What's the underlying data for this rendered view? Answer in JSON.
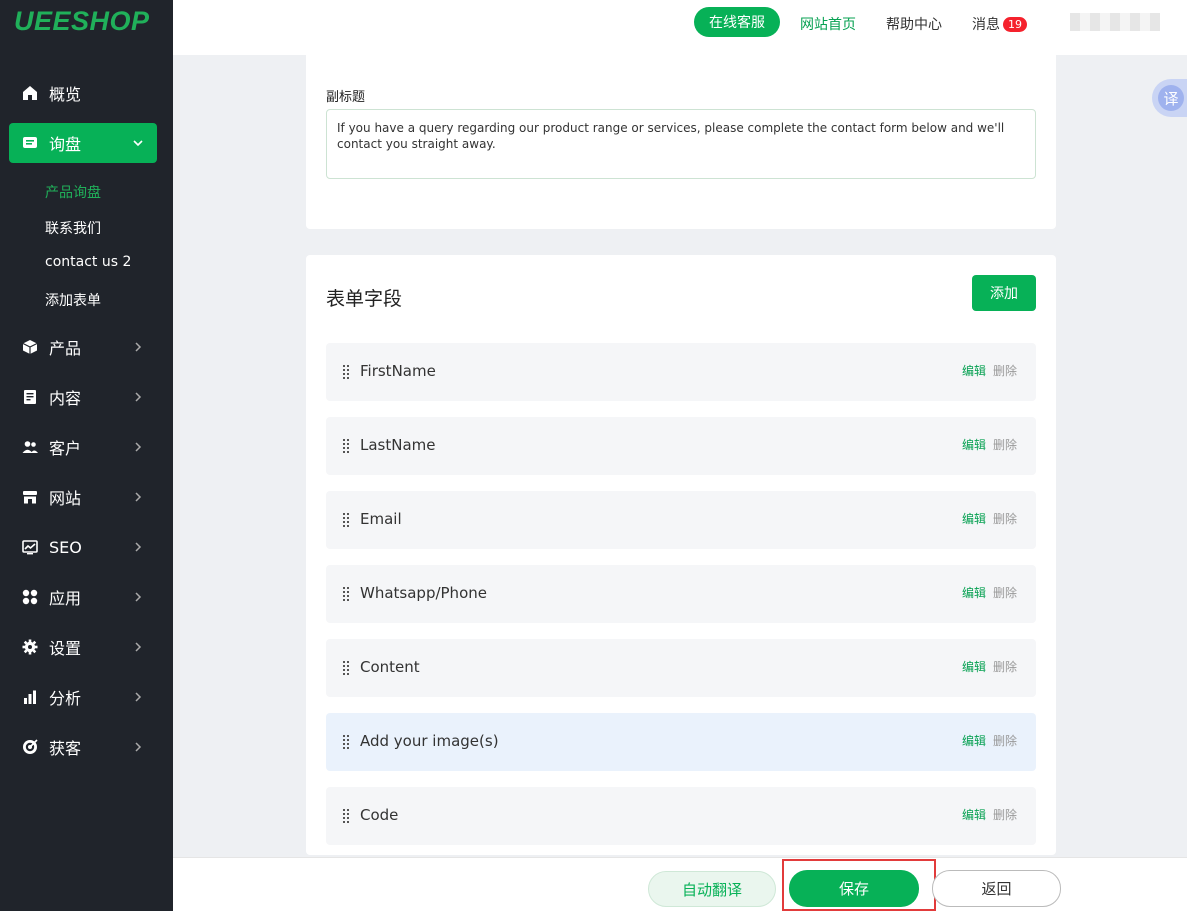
{
  "brand": {
    "logo": "UEESHOP"
  },
  "topbar": {
    "service_label": "在线客服",
    "home_label": "网站首页",
    "help_label": "帮助中心",
    "messages_label": "消息",
    "messages_count": "19"
  },
  "translate_float": {
    "label": "译"
  },
  "sidebar": {
    "items": [
      {
        "label": "概览",
        "icon": "home-icon"
      },
      {
        "label": "询盘",
        "icon": "inquiry-icon",
        "active": true
      },
      {
        "label": "产品",
        "icon": "cube-icon"
      },
      {
        "label": "内容",
        "icon": "document-icon"
      },
      {
        "label": "客户",
        "icon": "users-icon"
      },
      {
        "label": "网站",
        "icon": "store-icon"
      },
      {
        "label": "SEO",
        "icon": "seo-chart-icon"
      },
      {
        "label": "应用",
        "icon": "apps-icon"
      },
      {
        "label": "设置",
        "icon": "gear-icon"
      },
      {
        "label": "分析",
        "icon": "bar-chart-icon"
      },
      {
        "label": "获客",
        "icon": "target-icon"
      }
    ],
    "submenu": [
      {
        "label": "产品询盘",
        "active": true
      },
      {
        "label": "联系我们"
      },
      {
        "label": "contact us 2"
      },
      {
        "label": "添加表单"
      }
    ]
  },
  "subtitle_section": {
    "label": "副标题",
    "value": "If you have a query regarding our product range or services, please complete the contact form below and we'll contact you straight away."
  },
  "form_fields": {
    "title": "表单字段",
    "add_label": "添加",
    "edit_label": "编辑",
    "delete_label": "删除",
    "fields": [
      {
        "name": "FirstName"
      },
      {
        "name": "LastName"
      },
      {
        "name": "Email"
      },
      {
        "name": "Whatsapp/Phone"
      },
      {
        "name": "Content"
      },
      {
        "name": "Add your image(s)",
        "highlighted": true
      },
      {
        "name": "Code"
      }
    ]
  },
  "bottombar": {
    "auto_translate_label": "自动翻译",
    "save_label": "保存",
    "back_label": "返回"
  },
  "colors": {
    "accent": "#07b157",
    "sidebar_bg": "#20242b",
    "highlight_frame": "#e23b3b"
  }
}
